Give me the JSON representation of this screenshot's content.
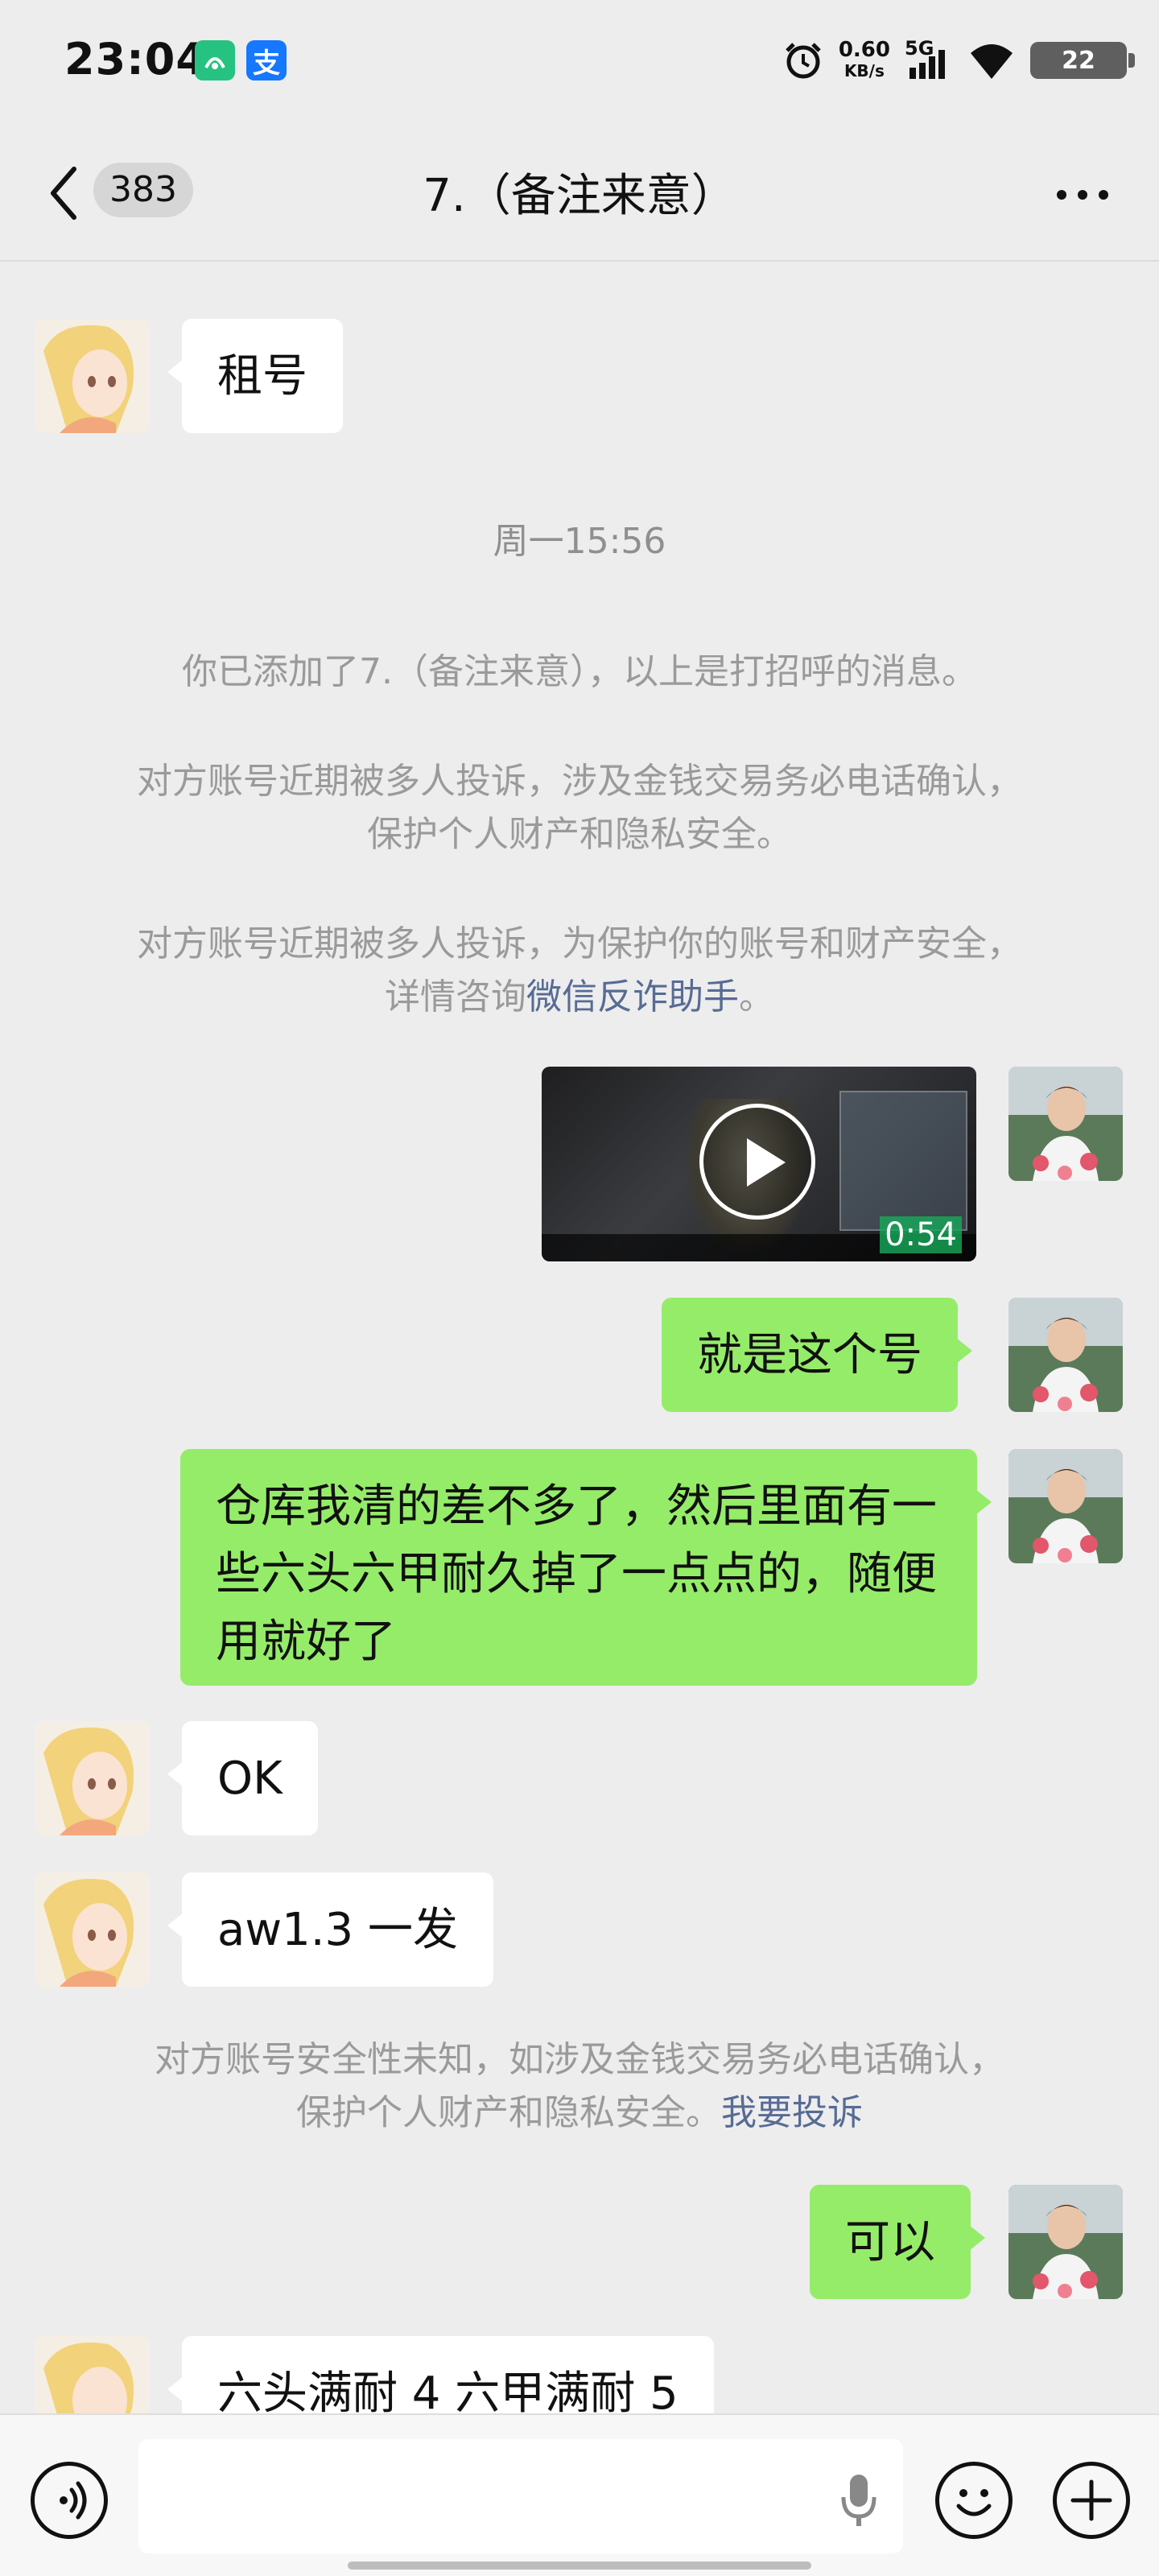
{
  "status_bar": {
    "time": "23:04",
    "app_icon_1": "app-notification-icon",
    "app_icon_2": "支",
    "net_speed_value": "0.60",
    "net_speed_unit": "KB/s",
    "network": "5G",
    "battery": "22"
  },
  "header": {
    "back_count": "383",
    "title": "7.（备注来意）"
  },
  "messages": {
    "m1": "租号",
    "timestamp": "周一15:56",
    "sys1": "你已添加了7.（备注来意），以上是打招呼的消息。",
    "sys2_line1": "对方账号近期被多人投诉，涉及金钱交易务必电话确认，",
    "sys2_line2": "保护个人财产和隐私安全。",
    "sys3_line1": "对方账号近期被多人投诉，为保护你的账号和财产安全，",
    "sys3_line2_prefix": "详情咨询",
    "sys3_link": "微信反诈助手",
    "sys3_suffix": "。",
    "video_duration": "0:54",
    "m2": "就是这个号",
    "m3": "仓库我清的差不多了，然后里面有一些六头六甲耐久掉了一点点的，随便用就好了",
    "m4": "OK",
    "m5": "aw1.3 一发",
    "sys4_line1": "对方账号安全性未知，如涉及金钱交易务必电话确认，",
    "sys4_line2_prefix": "保护个人财产和隐私安全。",
    "sys4_link": "我要投诉",
    "m6": "可以",
    "m7": "六头满耐 4 六甲满耐 5"
  },
  "colors": {
    "bg": "#EDEDED",
    "bubble_right": "#95EC69",
    "bubble_left": "#FFFFFF",
    "link": "#576B95"
  }
}
